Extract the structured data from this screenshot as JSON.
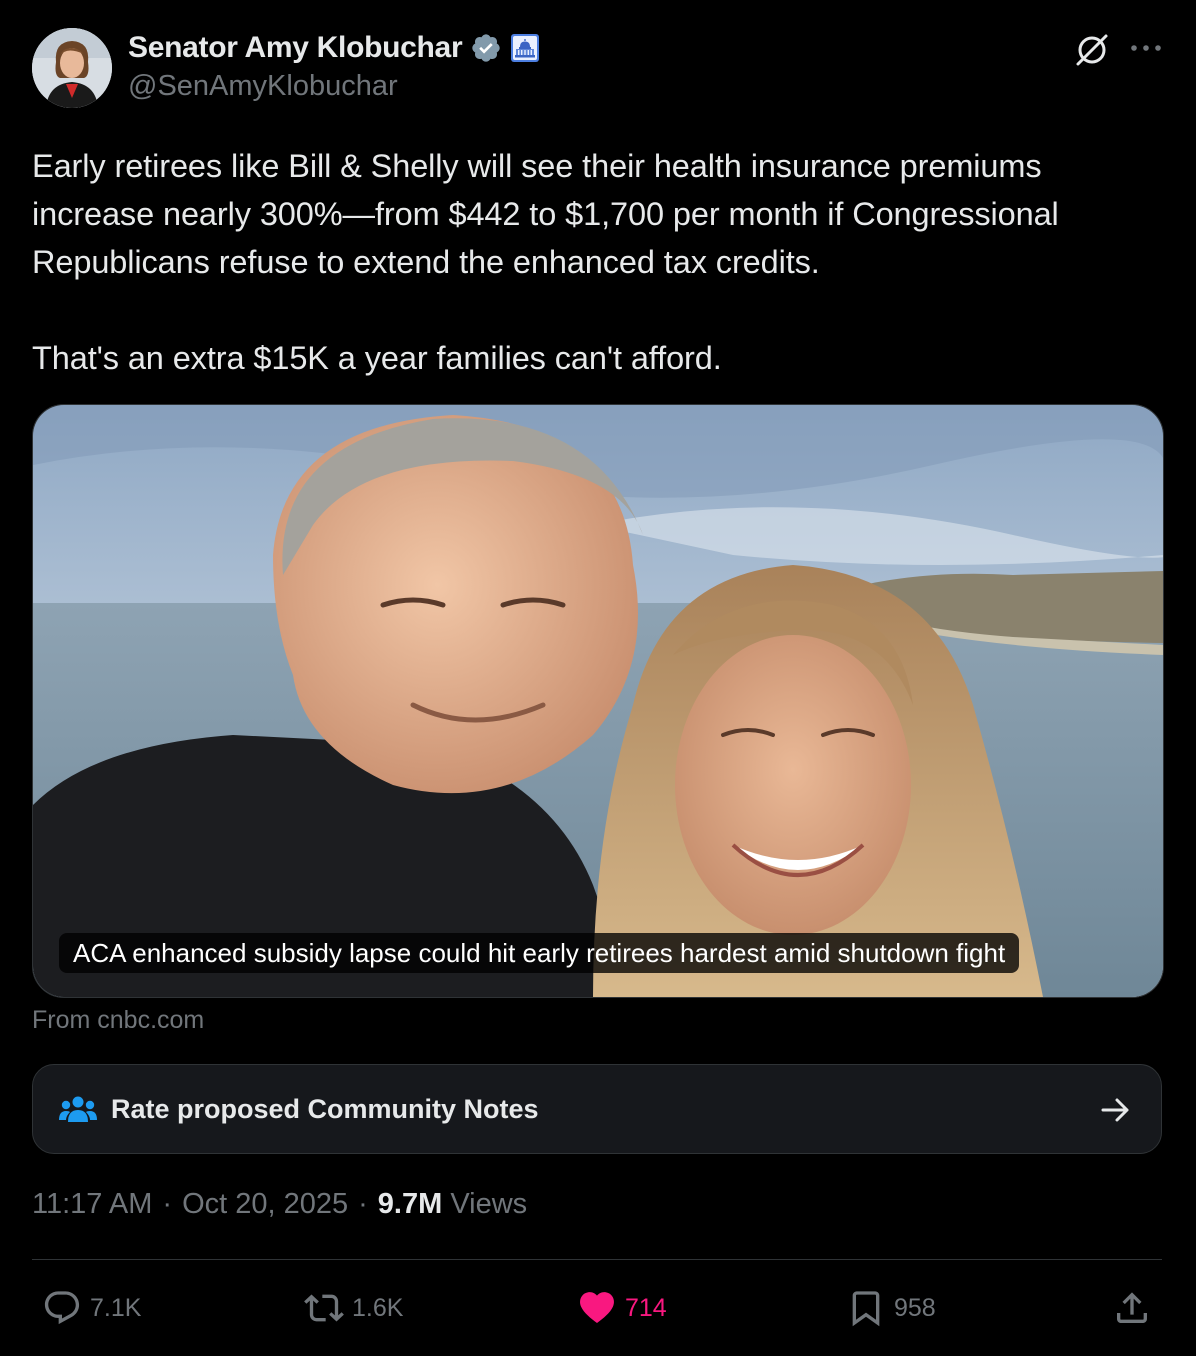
{
  "author": {
    "display_name": "Senator Amy Klobuchar",
    "handle": "@SenAmyKlobuchar"
  },
  "icons": {
    "verified": "verified-badge-icon",
    "government": "capitol-building-icon",
    "grok": "grok-icon",
    "more": "more-options-icon",
    "community": "community-notes-icon",
    "arrow": "arrow-right-icon",
    "reply": "reply-icon",
    "repost": "repost-icon",
    "like": "heart-icon",
    "bookmark": "bookmark-icon",
    "share": "share-icon"
  },
  "tweet": {
    "paragraph_1": "Early retirees like Bill & Shelly will see their health insurance premiums increase nearly 300%—from $442 to $1,700 per month if Congressional Republicans refuse to extend the enhanced tax credits.",
    "paragraph_2": "That's an extra $15K a year families can't afford."
  },
  "media": {
    "caption": "ACA enhanced subsidy lapse could hit early retirees hardest amid shutdown fight",
    "source": "From cnbc.com"
  },
  "community_notes": {
    "label": "Rate proposed Community Notes"
  },
  "meta": {
    "time": "11:17 AM",
    "separator": "·",
    "date": "Oct 20, 2025",
    "views_count": "9.7M",
    "views_label": "Views"
  },
  "actions": {
    "replies": "7.1K",
    "reposts": "1.6K",
    "likes": "714",
    "bookmarks": "958"
  },
  "colors": {
    "background": "#000000",
    "text": "#e7e9ea",
    "secondary": "#71767b",
    "like": "#f91880",
    "verified": "#829aab",
    "community_icon": "#1d9bf0"
  }
}
